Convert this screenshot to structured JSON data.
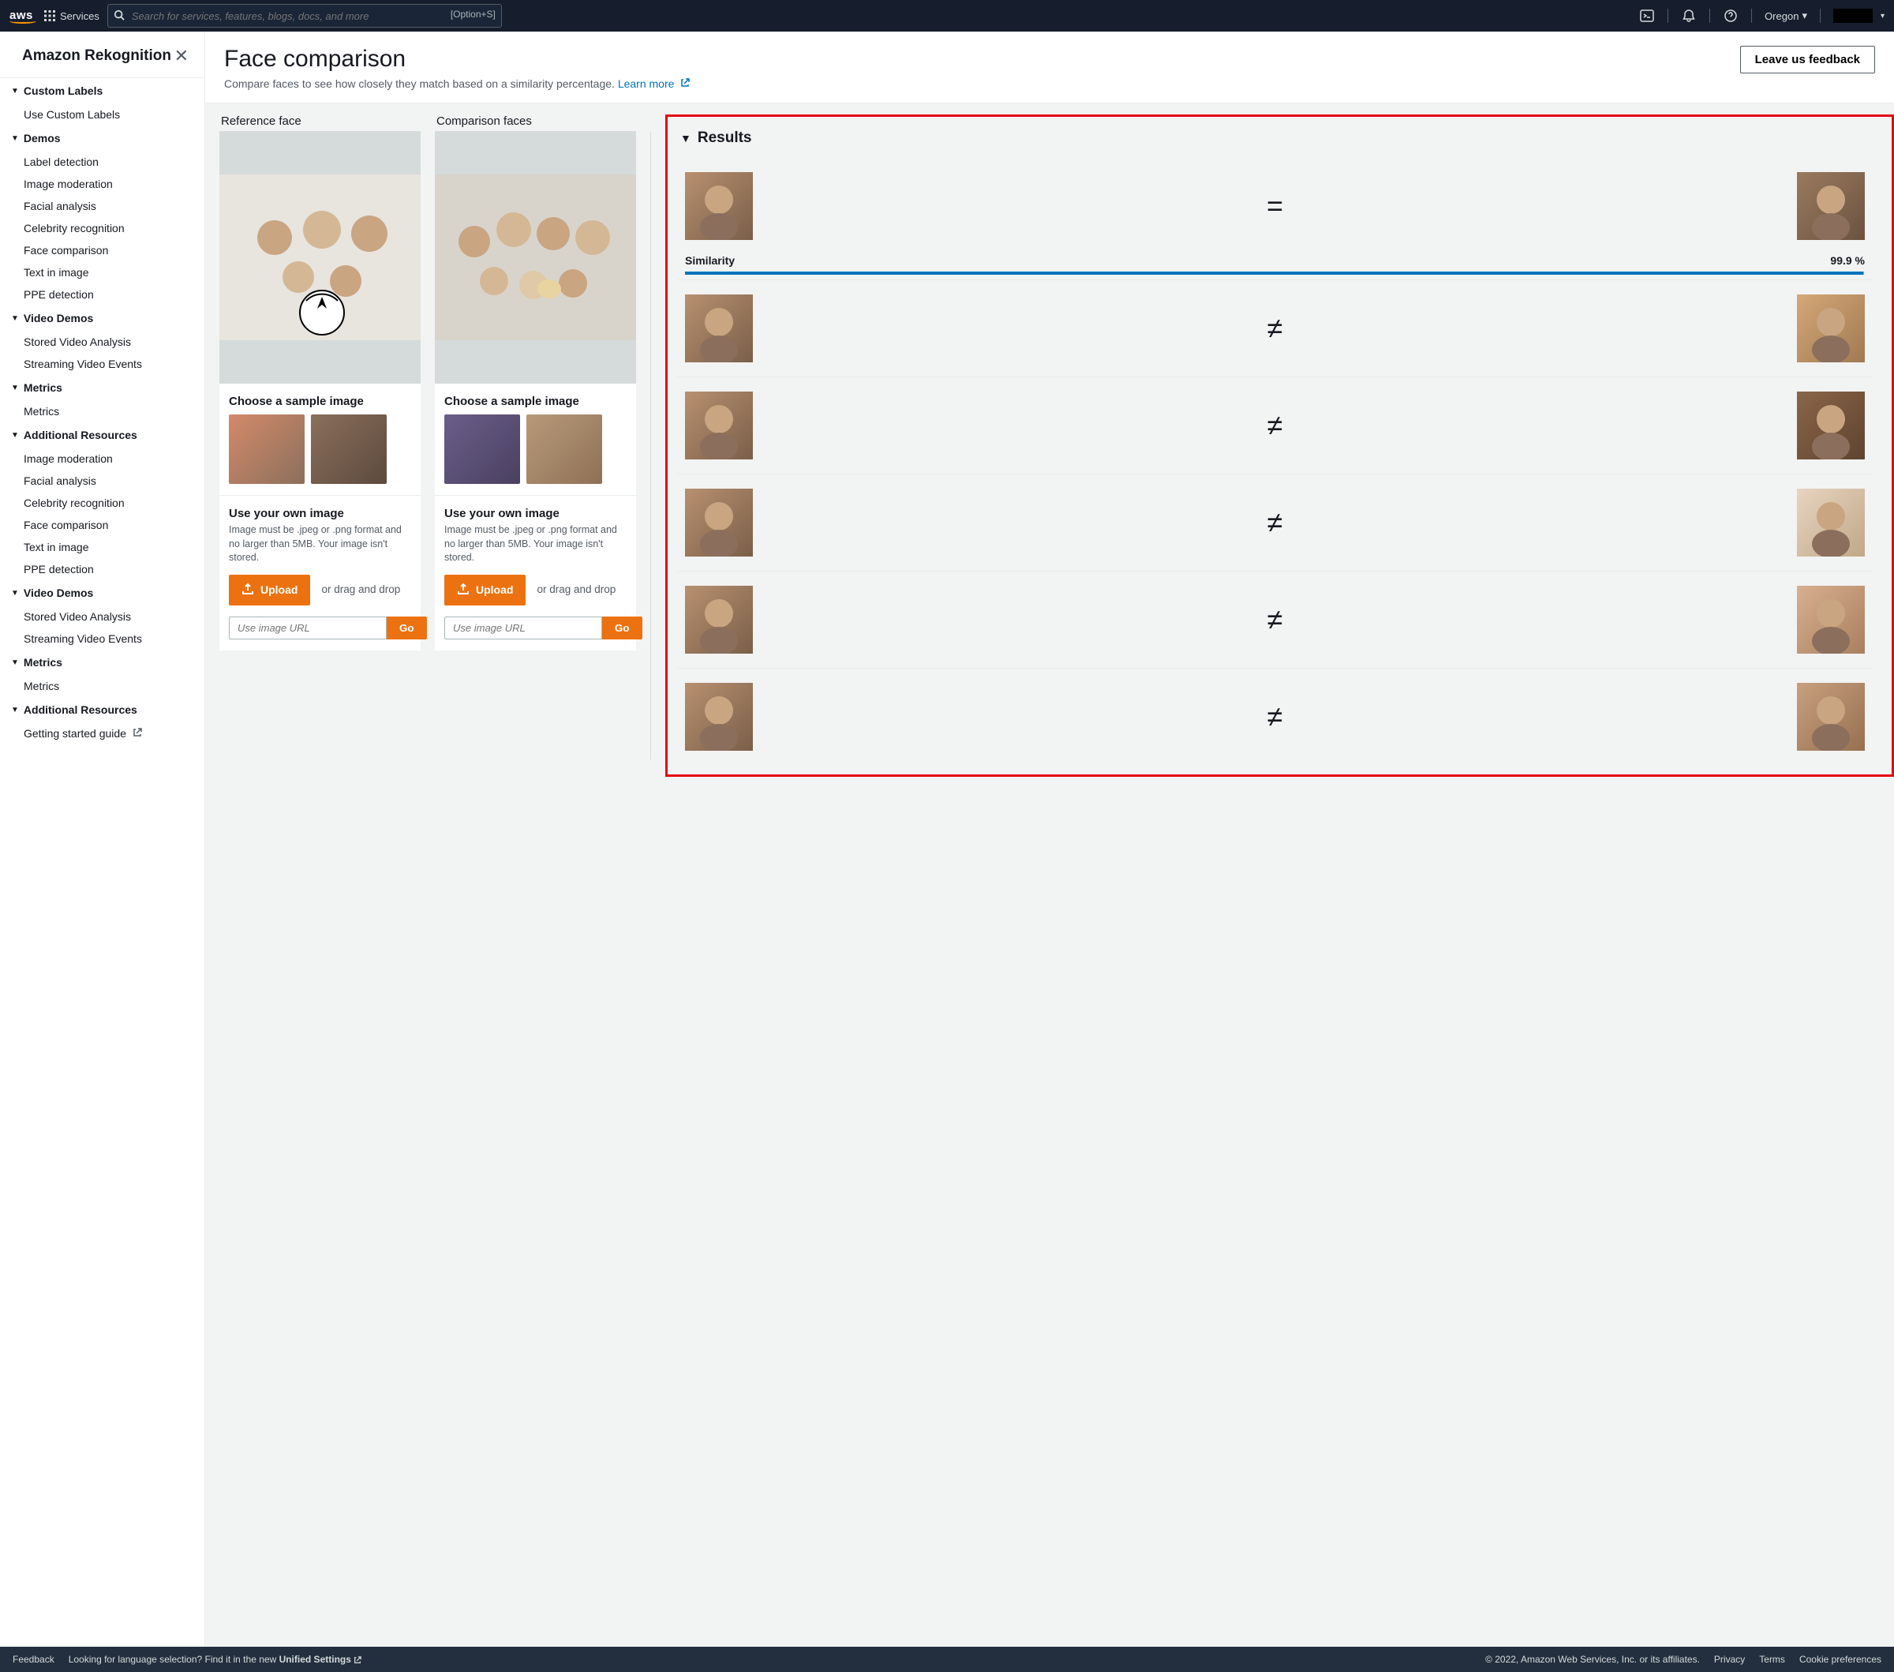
{
  "topnav": {
    "services": "Services",
    "search_placeholder": "Search for services, features, blogs, docs, and more",
    "search_shortcut": "[Option+S]",
    "region": "Oregon"
  },
  "sidebar": {
    "title": "Amazon Rekognition",
    "sections": [
      {
        "heading": "Custom Labels",
        "items": [
          "Use Custom Labels"
        ]
      },
      {
        "heading": "Demos",
        "items": [
          "Label detection",
          "Image moderation",
          "Facial analysis",
          "Celebrity recognition",
          "Face comparison",
          "Text in image",
          "PPE detection"
        ]
      },
      {
        "heading": "Video Demos",
        "items": [
          "Stored Video Analysis",
          "Streaming Video Events"
        ]
      },
      {
        "heading": "Metrics",
        "items": [
          "Metrics"
        ]
      },
      {
        "heading": "Additional Resources",
        "items": [
          "Image moderation",
          "Facial analysis",
          "Celebrity recognition",
          "Face comparison",
          "Text in image",
          "PPE detection"
        ]
      },
      {
        "heading": "Video Demos",
        "items": [
          "Stored Video Analysis",
          "Streaming Video Events"
        ]
      },
      {
        "heading": "Metrics",
        "items": [
          "Metrics"
        ]
      },
      {
        "heading": "Additional Resources",
        "items": [
          "Getting started guide"
        ]
      }
    ]
  },
  "page": {
    "title": "Face comparison",
    "description": "Compare faces to see how closely they match based on a similarity percentage.",
    "learn_more": "Learn more",
    "feedback_btn": "Leave us feedback"
  },
  "columns": {
    "reference_label": "Reference face",
    "comparison_label": "Comparison faces",
    "sample_title": "Choose a sample image",
    "own_title": "Use your own image",
    "own_desc": "Image must be .jpeg or .png format and no larger than 5MB. Your image isn't stored.",
    "upload_btn": "Upload",
    "drag_text": "or drag and drop",
    "url_placeholder": "Use image URL",
    "go_btn": "Go"
  },
  "results": {
    "title": "Results",
    "similarity_label": "Similarity",
    "similarity_value": "99.9 %",
    "items": [
      {
        "match": true
      },
      {
        "match": false
      },
      {
        "match": false
      },
      {
        "match": false
      },
      {
        "match": false
      },
      {
        "match": false
      }
    ]
  },
  "footer": {
    "feedback": "Feedback",
    "lang_text": "Looking for language selection? Find it in the new",
    "unified": "Unified Settings",
    "copyright": "© 2022, Amazon Web Services, Inc. or its affiliates.",
    "privacy": "Privacy",
    "terms": "Terms",
    "cookies": "Cookie preferences"
  }
}
